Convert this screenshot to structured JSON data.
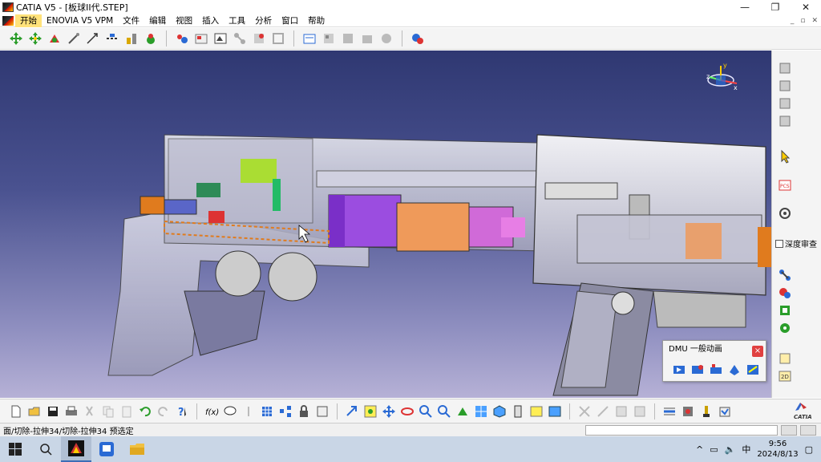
{
  "window": {
    "title": "CATIA V5 - [板球II代.STEP]",
    "controls": [
      "—",
      "❐",
      "✕"
    ]
  },
  "menu": {
    "items": [
      "开始",
      "ENOVIA V5 VPM",
      "文件",
      "编辑",
      "视图",
      "插入",
      "工具",
      "分析",
      "窗口",
      "帮助"
    ],
    "active_index": 0
  },
  "toolbar_top": {
    "icons": [
      "move-icon",
      "snap-icon",
      "manipulate-icon",
      "clash-icon",
      "distance-icon",
      "section-icon",
      "compare-icon",
      "product-icon",
      "catalog-icon",
      "update-icon",
      "graph-icon",
      "measure-icon",
      "sketch-icon",
      "publish-icon",
      "table-icon",
      "links-icon",
      "swap-icon",
      "parts-icon",
      "render-icon"
    ]
  },
  "dmu_panel": {
    "title": "DMU 一般动画",
    "close": "×",
    "icons": [
      "simulation-player-icon",
      "track-icon",
      "sequence-icon",
      "shuttle-icon",
      "animation-icon"
    ]
  },
  "right_toolbar": {
    "depth_check_label": "深度审查",
    "depth_check_checked": false
  },
  "compass": {
    "labels": [
      "x",
      "y",
      "z"
    ]
  },
  "bottom_toolbar": {
    "icons": [
      "new-icon",
      "open-icon",
      "save-icon",
      "print-icon",
      "cut-icon",
      "copy-icon",
      "paste-icon",
      "undo-icon",
      "redo-icon",
      "whatsthis-icon",
      "formula-icon",
      "knowledge-icon",
      "pointer-icon",
      "table-icon",
      "tree-icon",
      "lock-icon",
      "graph-icon",
      "pan-icon",
      "fit-all-icon",
      "move-icon",
      "rotate-icon",
      "zoom-in-icon",
      "zoom-out-icon",
      "normal-view-icon",
      "multiview-icon",
      "iso-view-icon",
      "shading-icon",
      "hide-icon",
      "swap-space-icon",
      "texture-icon",
      "clash-icon",
      "compare-icon",
      "catalog-icon",
      "fastener-icon",
      "align-icon",
      "product-icon",
      "material-icon"
    ]
  },
  "statusbar": {
    "text": "面/切除-拉伸34/切除-拉伸34 预选定"
  },
  "taskbar": {
    "time": "9:56",
    "date": "2024/8/13",
    "ime": "中"
  }
}
